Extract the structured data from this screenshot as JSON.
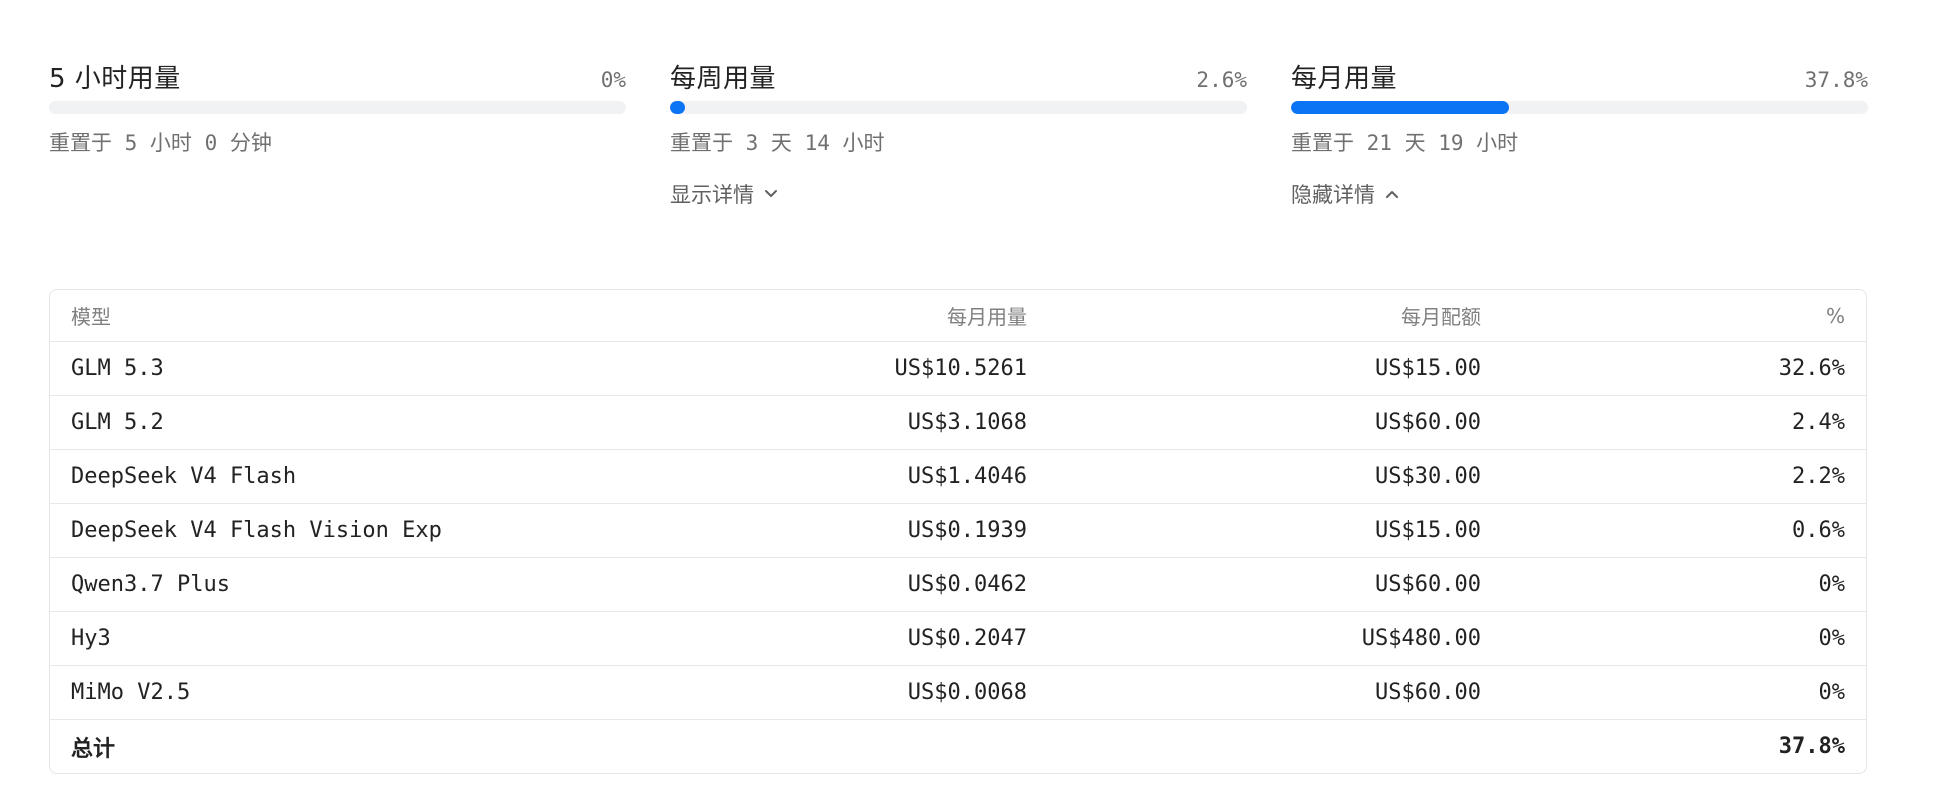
{
  "usage": {
    "hourly": {
      "title": "5 小时用量",
      "percent": "0%",
      "fill": 0.0,
      "reset": "重置于 5 小时 0 分钟"
    },
    "weekly": {
      "title": "每周用量",
      "percent": "2.6%",
      "fill": 0.026,
      "reset": "重置于 3 天 14 小时",
      "toggle_label": "显示详情"
    },
    "monthly": {
      "title": "每月用量",
      "percent": "37.8%",
      "fill": 0.378,
      "reset": "重置于 21 天 19 小时",
      "toggle_label": "隐藏详情"
    }
  },
  "accent_color": "#0a74f5",
  "table": {
    "headers": {
      "model": "模型",
      "usage": "每月用量",
      "quota": "每月配额",
      "pct": "%"
    },
    "rows": [
      {
        "model": "GLM 5.3",
        "usage": "US$10.5261",
        "quota": "US$15.00",
        "pct": "32.6%"
      },
      {
        "model": "GLM 5.2",
        "usage": "US$3.1068",
        "quota": "US$60.00",
        "pct": "2.4%"
      },
      {
        "model": "DeepSeek V4 Flash",
        "usage": "US$1.4046",
        "quota": "US$30.00",
        "pct": "2.2%"
      },
      {
        "model": "DeepSeek V4 Flash Vision Exp",
        "usage": "US$0.1939",
        "quota": "US$15.00",
        "pct": "0.6%"
      },
      {
        "model": "Qwen3.7 Plus",
        "usage": "US$0.0462",
        "quota": "US$60.00",
        "pct": "0%"
      },
      {
        "model": "Hy3",
        "usage": "US$0.2047",
        "quota": "US$480.00",
        "pct": "0%"
      },
      {
        "model": "MiMo V2.5",
        "usage": "US$0.0068",
        "quota": "US$60.00",
        "pct": "0%"
      }
    ],
    "total": {
      "label": "总计",
      "pct": "37.8%"
    }
  }
}
